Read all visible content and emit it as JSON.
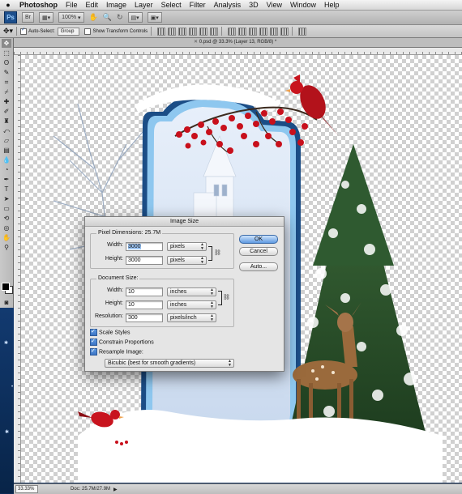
{
  "menubar": {
    "items": [
      "Photoshop",
      "File",
      "Edit",
      "Image",
      "Layer",
      "Select",
      "Filter",
      "Analysis",
      "3D",
      "View",
      "Window",
      "Help"
    ]
  },
  "appbar": {
    "logo": "Ps",
    "zoom": "100%"
  },
  "options": {
    "auto_select_label": "Auto-Select:",
    "auto_select_checked": true,
    "auto_select_value": "Group",
    "transform_label": "Show Transform Controls",
    "transform_checked": false
  },
  "document": {
    "tab_title": "0.psd @ 33.3% (Layer 13, RGB/8) *"
  },
  "status": {
    "zoom": "33.33%",
    "doc_size": "Doc: 25.7M/27.9M"
  },
  "dialog": {
    "title": "Image Size",
    "pixel_dimensions_label": "Pixel Dimensions:",
    "pixel_dimensions_value": "25.7M",
    "width_label": "Width:",
    "height_label": "Height:",
    "pixel_width": "3000",
    "pixel_height": "3000",
    "pixel_width_unit": "pixels",
    "pixel_height_unit": "pixels",
    "document_size_label": "Document Size:",
    "doc_width": "10",
    "doc_height": "10",
    "doc_width_unit": "inches",
    "doc_height_unit": "inches",
    "resolution_label": "Resolution:",
    "resolution": "300",
    "resolution_unit": "pixels/inch",
    "scale_styles": "Scale Styles",
    "constrain": "Constrain Proportions",
    "resample": "Resample Image:",
    "resample_method": "Bicubic (best for smooth gradients)",
    "ok": "OK",
    "cancel": "Cancel",
    "auto": "Auto..."
  }
}
